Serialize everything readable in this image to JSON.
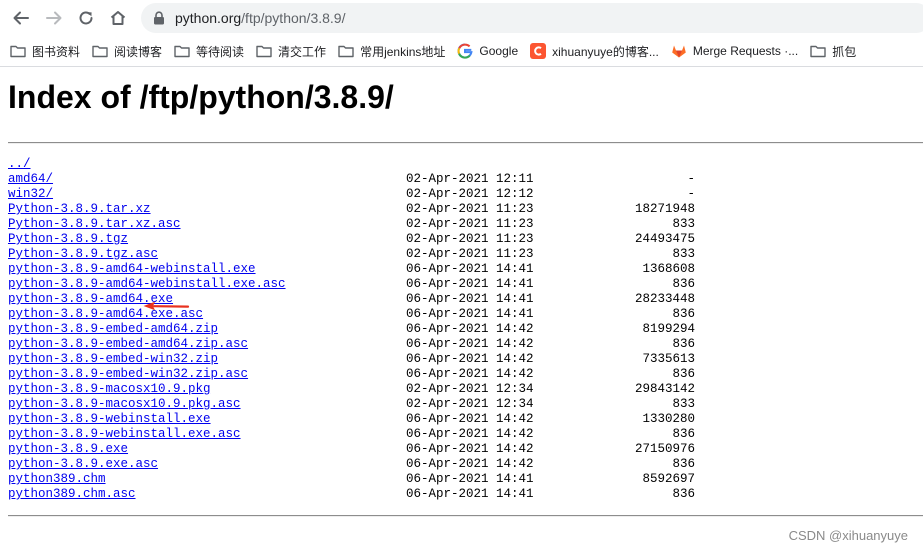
{
  "browser": {
    "url_host": "python.org",
    "url_path": "/ftp/python/3.8.9/"
  },
  "bookmarks": [
    {
      "label": "图书资料",
      "icon": "folder-icon"
    },
    {
      "label": "阅读博客",
      "icon": "folder-icon"
    },
    {
      "label": "等待阅读",
      "icon": "folder-icon"
    },
    {
      "label": "清交工作",
      "icon": "folder-icon"
    },
    {
      "label": "常用jenkins地址",
      "icon": "folder-icon"
    },
    {
      "label": "Google",
      "icon": "google-icon"
    },
    {
      "label": "xihuanyuye的博客...",
      "icon": "csdn-icon"
    },
    {
      "label": "Merge Requests ·...",
      "icon": "gitlab-icon"
    },
    {
      "label": "抓包",
      "icon": "folder-icon"
    }
  ],
  "page": {
    "title": "Index of /ftp/python/3.8.9/",
    "parent_link": "../",
    "files": [
      {
        "name": "amd64/",
        "date": "02-Apr-2021 12:11",
        "size": "-"
      },
      {
        "name": "win32/",
        "date": "02-Apr-2021 12:12",
        "size": "-"
      },
      {
        "name": "Python-3.8.9.tar.xz",
        "date": "02-Apr-2021 11:23",
        "size": "18271948"
      },
      {
        "name": "Python-3.8.9.tar.xz.asc",
        "date": "02-Apr-2021 11:23",
        "size": "833"
      },
      {
        "name": "Python-3.8.9.tgz",
        "date": "02-Apr-2021 11:23",
        "size": "24493475"
      },
      {
        "name": "Python-3.8.9.tgz.asc",
        "date": "02-Apr-2021 11:23",
        "size": "833"
      },
      {
        "name": "python-3.8.9-amd64-webinstall.exe",
        "date": "06-Apr-2021 14:41",
        "size": "1368608"
      },
      {
        "name": "python-3.8.9-amd64-webinstall.exe.asc",
        "date": "06-Apr-2021 14:41",
        "size": "836"
      },
      {
        "name": "python-3.8.9-amd64.exe",
        "date": "06-Apr-2021 14:41",
        "size": "28233448"
      },
      {
        "name": "python-3.8.9-amd64.exe.asc",
        "date": "06-Apr-2021 14:41",
        "size": "836"
      },
      {
        "name": "python-3.8.9-embed-amd64.zip",
        "date": "06-Apr-2021 14:42",
        "size": "8199294"
      },
      {
        "name": "python-3.8.9-embed-amd64.zip.asc",
        "date": "06-Apr-2021 14:42",
        "size": "836"
      },
      {
        "name": "python-3.8.9-embed-win32.zip",
        "date": "06-Apr-2021 14:42",
        "size": "7335613"
      },
      {
        "name": "python-3.8.9-embed-win32.zip.asc",
        "date": "06-Apr-2021 14:42",
        "size": "836"
      },
      {
        "name": "python-3.8.9-macosx10.9.pkg",
        "date": "02-Apr-2021 12:34",
        "size": "29843142"
      },
      {
        "name": "python-3.8.9-macosx10.9.pkg.asc",
        "date": "02-Apr-2021 12:34",
        "size": "833"
      },
      {
        "name": "python-3.8.9-webinstall.exe",
        "date": "06-Apr-2021 14:42",
        "size": "1330280"
      },
      {
        "name": "python-3.8.9-webinstall.exe.asc",
        "date": "06-Apr-2021 14:42",
        "size": "836"
      },
      {
        "name": "python-3.8.9.exe",
        "date": "06-Apr-2021 14:42",
        "size": "27150976"
      },
      {
        "name": "python-3.8.9.exe.asc",
        "date": "06-Apr-2021 14:42",
        "size": "836"
      },
      {
        "name": "python389.chm",
        "date": "06-Apr-2021 14:41",
        "size": "8592697"
      },
      {
        "name": "python389.chm.asc",
        "date": "06-Apr-2021 14:41",
        "size": "836"
      }
    ]
  },
  "annotation": {
    "target_file": "Python-3.8.9.tgz",
    "arrow_color": "#e8321f"
  },
  "watermark": "CSDN @xihuanyuye",
  "colors": {
    "link": "#0000ee",
    "toolbar_bg": "#ffffff",
    "omnibox_bg": "#f1f3f4"
  }
}
